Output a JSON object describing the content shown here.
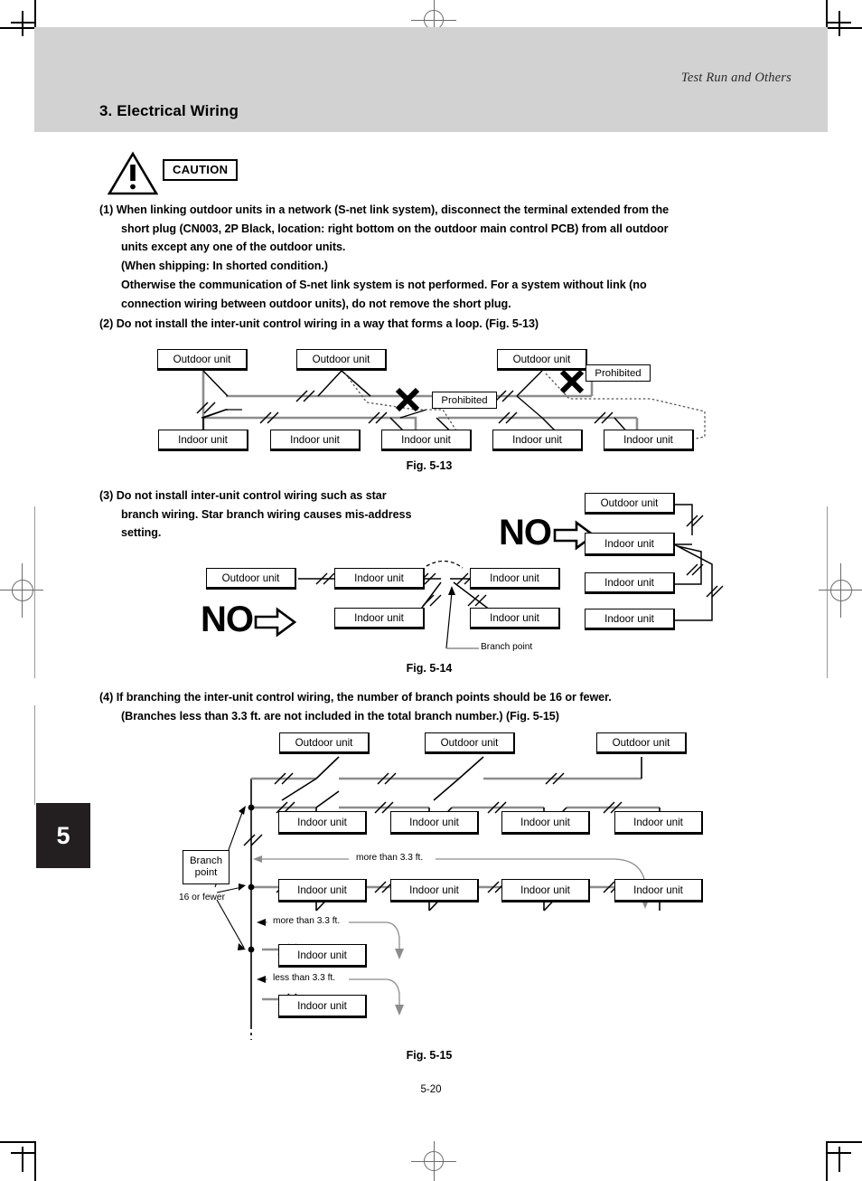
{
  "page": {
    "running_head": "Test Run and Others",
    "section_title": "3. Electrical Wiring",
    "chapter_tab": "5",
    "page_number": "5-20"
  },
  "caution": {
    "label": "CAUTION",
    "icon": "warning-triangle-icon"
  },
  "items": {
    "item1_line1": "(1) When linking outdoor units in a network (S-net link system), disconnect the terminal extended from the",
    "item1_line2": "short plug (CN003, 2P Black, location: right bottom on the outdoor main control PCB) from all outdoor",
    "item1_line3": "units except any one of the outdoor units.",
    "item1_line4": "(When shipping: In shorted condition.)",
    "item1_note1": "Otherwise the communication of S-net link system is not performed. For a system without link (no",
    "item1_note2": "connection wiring between outdoor units), do not remove the short plug.",
    "item2": "(2) Do not install the inter-unit control wiring in a way that forms a loop. (Fig. 5-13)",
    "item3_line1": "(3) Do not install inter-unit control wiring such as star",
    "item3_line2": "branch wiring. Star branch wiring causes mis-address",
    "item3_line3": "setting.",
    "item4_line1": "(4) If branching the inter-unit control wiring, the number of branch points should be 16 or fewer.",
    "item4_line2": "(Branches less than 3.3 ft. are not included in the total branch number.) (Fig. 5-15)"
  },
  "labels": {
    "outdoor_unit": "Outdoor unit",
    "indoor_unit": "Indoor unit",
    "prohibited": "Prohibited",
    "branch_point": "Branch point",
    "branch_point_l1": "Branch",
    "branch_point_l2": "point",
    "sixteen_or_fewer": "16 or fewer",
    "more_than": "more than 3.3 ft.",
    "less_than": "less than 3.3 ft.",
    "no_mark": "NO"
  },
  "figures": {
    "fig13": {
      "caption": "Fig. 5-13",
      "outdoor_units": [
        "Outdoor unit",
        "Outdoor unit",
        "Outdoor unit"
      ],
      "indoor_units": [
        "Indoor unit",
        "Indoor unit",
        "Indoor unit",
        "Indoor unit",
        "Indoor unit"
      ],
      "prohibited_labels": [
        "Prohibited",
        "Prohibited"
      ]
    },
    "fig14": {
      "caption": "Fig. 5-14",
      "left_outdoor": "Outdoor unit",
      "left_indoor_units": [
        "Indoor unit",
        "Indoor unit",
        "Indoor unit",
        "Indoor unit"
      ],
      "branch_point": "Branch point",
      "right_outdoor": "Outdoor unit",
      "right_indoor_units": [
        "Indoor unit",
        "Indoor unit",
        "Indoor unit"
      ],
      "no_left": "NO",
      "no_right": "NO"
    },
    "fig15": {
      "caption": "Fig. 5-15",
      "outdoor_units": [
        "Outdoor unit",
        "Outdoor unit",
        "Outdoor unit"
      ],
      "row1_indoor": [
        "Indoor unit",
        "Indoor unit",
        "Indoor unit",
        "Indoor unit"
      ],
      "row2_indoor": [
        "Indoor unit",
        "Indoor unit",
        "Indoor unit",
        "Indoor unit"
      ],
      "branch_indoor_1": "Indoor unit",
      "branch_indoor_2": "Indoor unit",
      "dim_row": "more than 3.3 ft.",
      "dim_branch1": "more than 3.3 ft.",
      "dim_branch2": "less than 3.3 ft.",
      "branch_box_l1": "Branch",
      "branch_box_l2": "point",
      "limit_note": "16 or fewer"
    }
  },
  "colors": {
    "header_band": "#d2d2d2",
    "tab_bg": "#231f20",
    "wire_gray": "#8c8c8c",
    "text": "#000000"
  }
}
